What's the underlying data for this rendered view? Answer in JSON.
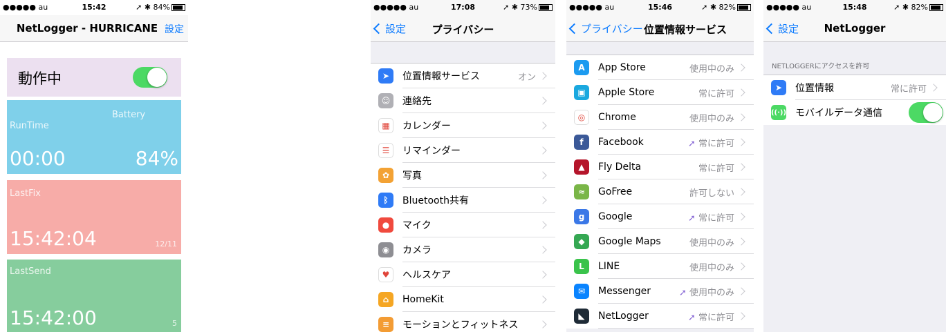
{
  "screen1": {
    "status": {
      "carrier": "●●●●● au",
      "time": "15:42",
      "right": "84%"
    },
    "title": "NetLogger - HURRICANE",
    "settings_link": "設定",
    "running": {
      "label": "動作中",
      "on": true
    },
    "runtime": {
      "label": "RunTime",
      "battery_label": "Battery",
      "value": "00:00",
      "battery_value": "84%"
    },
    "lastfix": {
      "label": "LastFix",
      "value": "15:42:04",
      "date": "12/11"
    },
    "lastsend": {
      "label": "LastSend",
      "value": "15:42:00",
      "count": "5"
    },
    "colors": {
      "running_bg": "#ece0f0",
      "runtime_bg": "#7fd0ea",
      "lastfix_bg": "#f7aca8",
      "lastsend_bg": "#86cd9d"
    }
  },
  "screen2": {
    "status": {
      "carrier": "●●●●● au",
      "time": "17:08",
      "right": "73%"
    },
    "title": "プライバシー",
    "back": "設定",
    "items": [
      {
        "label": "位置情報サービス",
        "value": "オン",
        "icon": "location-icon",
        "color": "#2f7bf6"
      },
      {
        "label": "連絡先",
        "value": "",
        "icon": "contacts-icon",
        "color": "#b0b0b5"
      },
      {
        "label": "カレンダー",
        "value": "",
        "icon": "calendar-icon",
        "color": "#ffffff"
      },
      {
        "label": "リマインダー",
        "value": "",
        "icon": "reminders-icon",
        "color": "#ffffff"
      },
      {
        "label": "写真",
        "value": "",
        "icon": "photos-icon",
        "color": "#f3a234"
      },
      {
        "label": "Bluetooth共有",
        "value": "",
        "icon": "bluetooth-icon",
        "color": "#2f7bf6"
      },
      {
        "label": "マイク",
        "value": "",
        "icon": "microphone-icon",
        "color": "#f04a3e"
      },
      {
        "label": "カメラ",
        "value": "",
        "icon": "camera-icon",
        "color": "#8e8e93"
      },
      {
        "label": "ヘルスケア",
        "value": "",
        "icon": "health-icon",
        "color": "#ffffff"
      },
      {
        "label": "HomeKit",
        "value": "",
        "icon": "homekit-icon",
        "color": "#f5a623"
      },
      {
        "label": "モーションとフィットネス",
        "value": "",
        "icon": "motion-icon",
        "color": "#f39c34"
      }
    ]
  },
  "screen3": {
    "status": {
      "carrier": "●●●●● au",
      "time": "15:46",
      "right": "82%"
    },
    "title": "位置情報サービス",
    "back": "プライバシー",
    "items": [
      {
        "label": "App Store",
        "value": "使用中のみ",
        "arrow": false,
        "icon": "appstore-icon",
        "color": "#1c9bf0"
      },
      {
        "label": "Apple Store",
        "value": "常に許可",
        "arrow": false,
        "icon": "applestore-icon",
        "color": "#1aa8df"
      },
      {
        "label": "Chrome",
        "value": "使用中のみ",
        "arrow": false,
        "icon": "chrome-icon",
        "color": "#ffffff"
      },
      {
        "label": "Facebook",
        "value": "常に許可",
        "arrow": true,
        "icon": "facebook-icon",
        "color": "#3b5998"
      },
      {
        "label": "Fly Delta",
        "value": "常に許可",
        "arrow": false,
        "icon": "delta-icon",
        "color": "#b5152b"
      },
      {
        "label": "GoFree",
        "value": "許可しない",
        "arrow": false,
        "icon": "gofree-icon",
        "color": "#7ab648"
      },
      {
        "label": "Google",
        "value": "常に許可",
        "arrow": true,
        "icon": "google-icon",
        "color": "#3b78e7"
      },
      {
        "label": "Google Maps",
        "value": "使用中のみ",
        "arrow": false,
        "icon": "googlemaps-icon",
        "color": "#35a853"
      },
      {
        "label": "LINE",
        "value": "使用中のみ",
        "arrow": false,
        "icon": "line-icon",
        "color": "#3ac34b"
      },
      {
        "label": "Messenger",
        "value": "使用中のみ",
        "arrow": true,
        "icon": "messenger-icon",
        "color": "#0a84ff"
      },
      {
        "label": "NetLogger",
        "value": "常に許可",
        "arrow": true,
        "icon": "netlogger-icon",
        "color": "#1e2a36"
      }
    ]
  },
  "screen4": {
    "status": {
      "carrier": "●●●●● au",
      "time": "15:48",
      "right": "82%"
    },
    "title": "NetLogger",
    "back": "設定",
    "section_header": "NETLOGGERにアクセスを許可",
    "location": {
      "label": "位置情報",
      "value": "常に許可"
    },
    "cellular": {
      "label": "モバイルデータ通信",
      "on": true
    }
  }
}
